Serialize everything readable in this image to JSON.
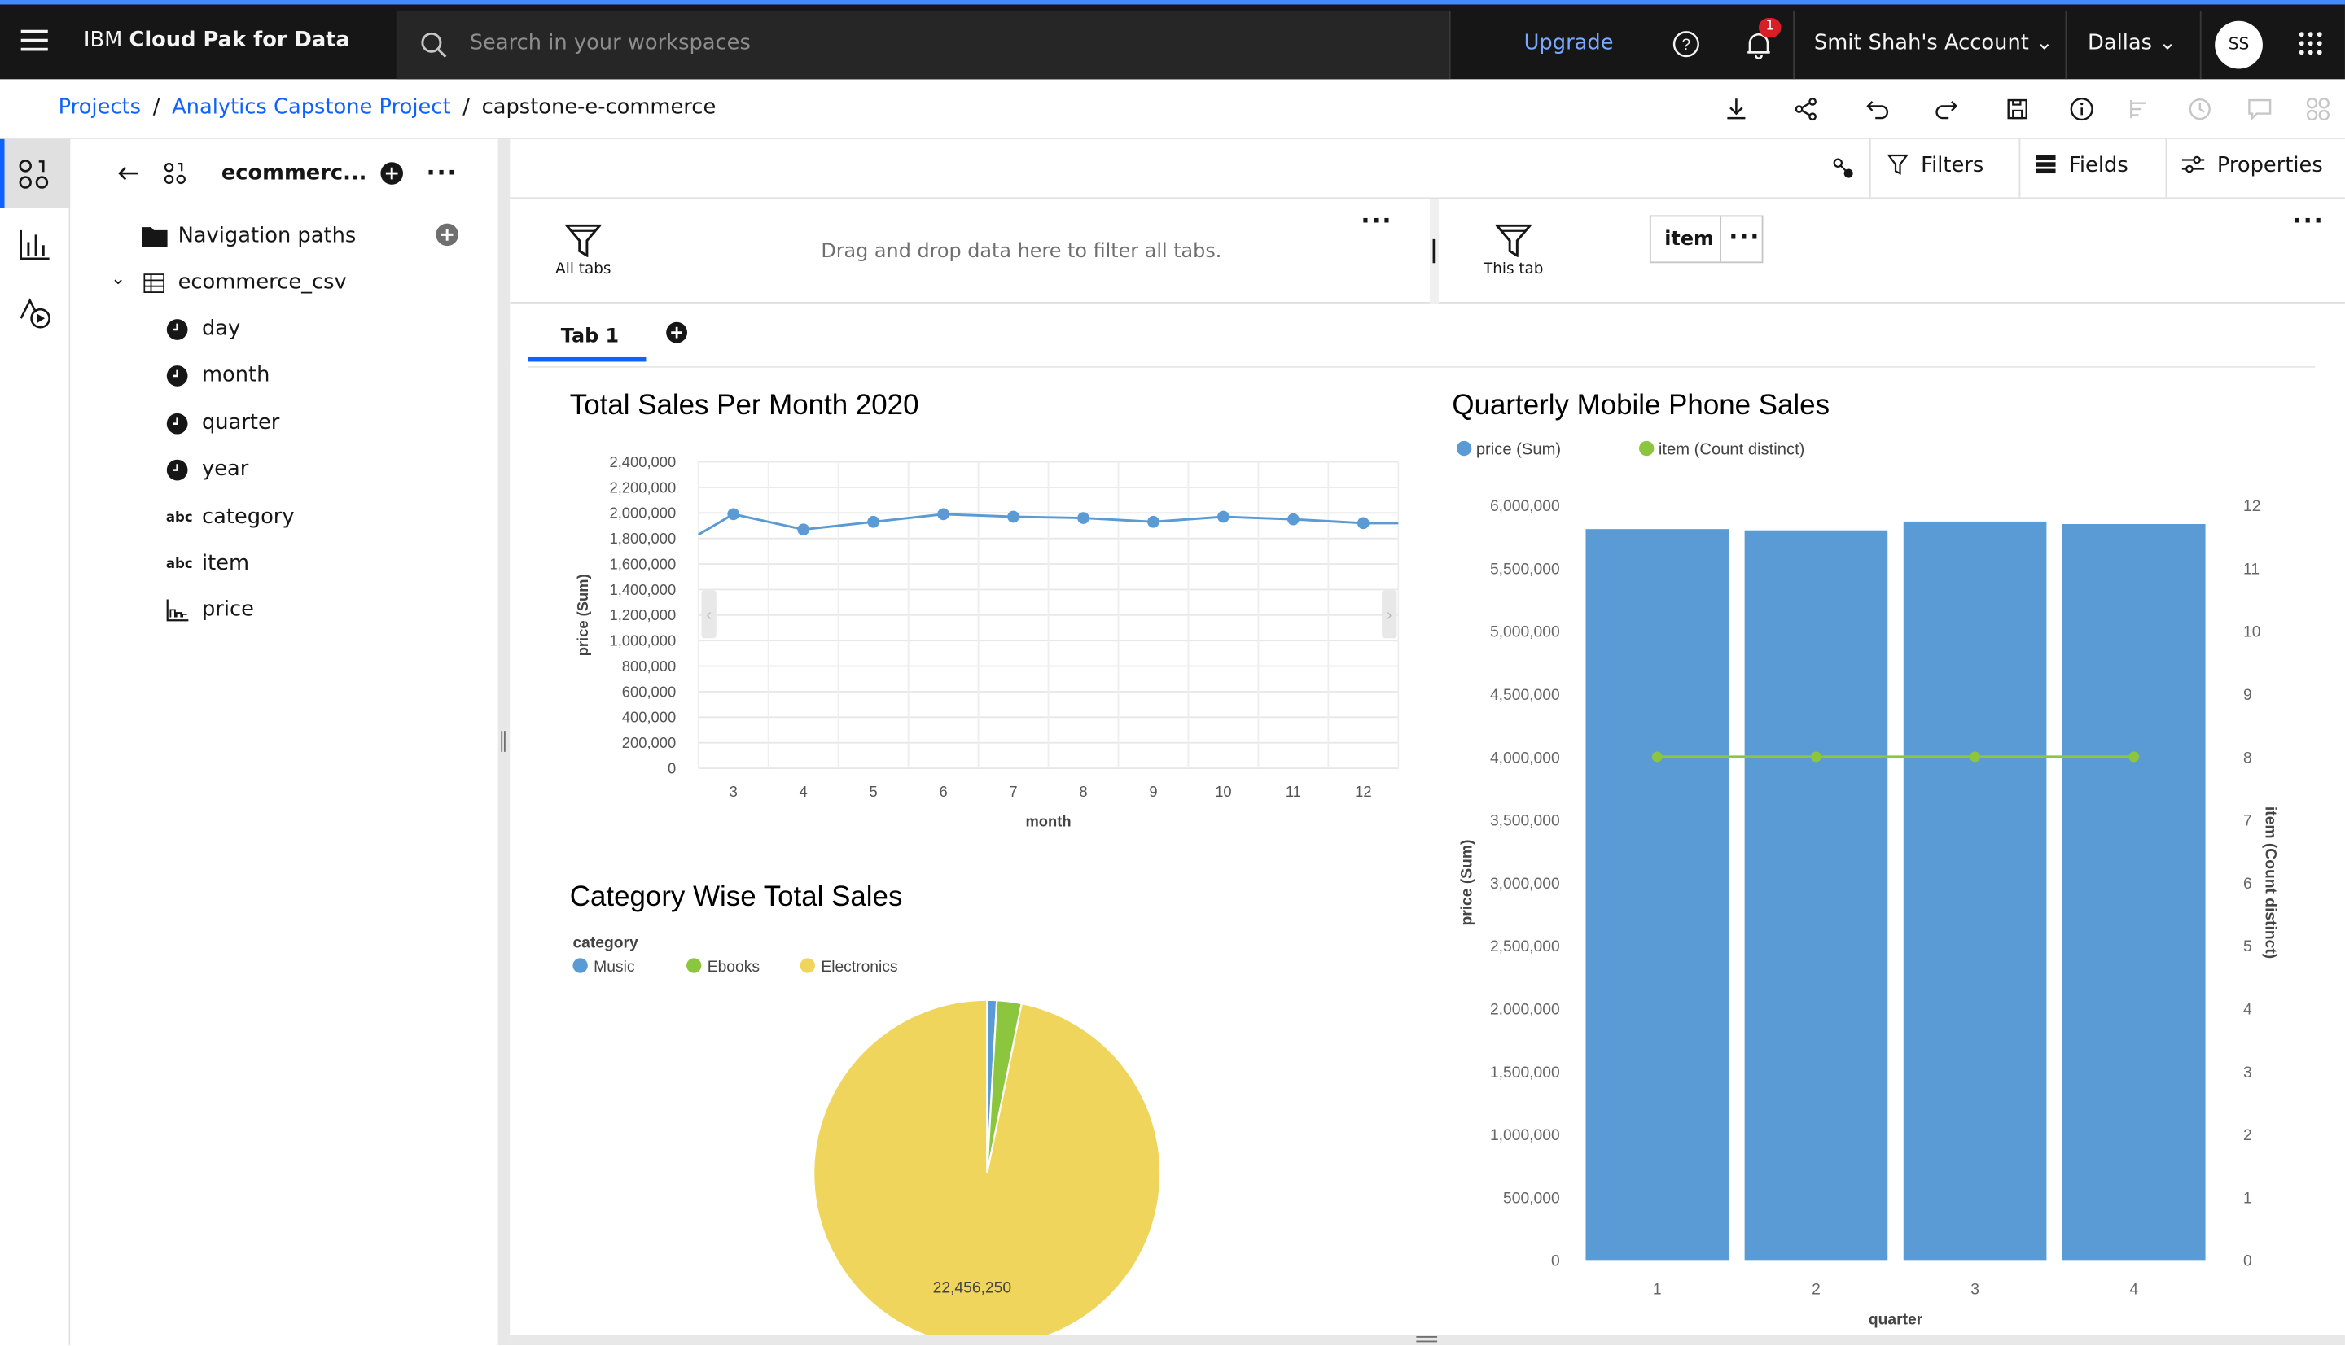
{
  "topbar": {
    "brand_prefix": "IBM ",
    "brand_name": "Cloud Pak for Data",
    "search_placeholder": "Search in your workspaces",
    "upgrade": "Upgrade",
    "notification_count": "1",
    "account": "Smit Shah's Account",
    "region": "Dallas",
    "avatar": "SS"
  },
  "breadcrumb": {
    "items": [
      "Projects",
      "Analytics Capstone Project"
    ],
    "current": "capstone-e-commerce"
  },
  "panel": {
    "title": "ecommerc...",
    "navigation_paths": "Navigation paths",
    "table_name": "ecommerce_csv",
    "fields": [
      {
        "name": "day",
        "type": "time"
      },
      {
        "name": "month",
        "type": "time"
      },
      {
        "name": "quarter",
        "type": "time"
      },
      {
        "name": "year",
        "type": "time"
      },
      {
        "name": "category",
        "type": "text"
      },
      {
        "name": "item",
        "type": "text"
      },
      {
        "name": "price",
        "type": "measure"
      }
    ],
    "abc_label": "abc"
  },
  "toolbar": {
    "filters": "Filters",
    "fields": "Fields",
    "properties": "Properties"
  },
  "filter_bar": {
    "all_tabs": "All tabs",
    "drag_text": "Drag and drop data here to filter all tabs.",
    "this_tab": "This tab",
    "item_chip": "item"
  },
  "tabs": [
    {
      "label": "Tab 1"
    }
  ],
  "chart_data": [
    {
      "type": "line",
      "title": "Total Sales Per Month 2020",
      "xlabel": "month",
      "ylabel": "price (Sum)",
      "x": [
        3,
        4,
        5,
        6,
        7,
        8,
        9,
        10,
        11,
        12
      ],
      "values": [
        1990000,
        1870000,
        1930000,
        1990000,
        1970000,
        1960000,
        1930000,
        1970000,
        1950000,
        1920000
      ],
      "partial_left_value": 1830000,
      "ylim": [
        0,
        2400000
      ],
      "yticks": [
        "2,400,000",
        "2,200,000",
        "2,000,000",
        "1,800,000",
        "1,600,000",
        "1,400,000",
        "1,200,000",
        "1,000,000",
        "800,000",
        "600,000",
        "400,000",
        "200,000",
        "0"
      ],
      "xticks": [
        "3",
        "4",
        "5",
        "6",
        "7",
        "8",
        "9",
        "10",
        "11",
        "12"
      ],
      "color": "#5b9bd5",
      "grid": true
    },
    {
      "type": "bar",
      "title": "Quarterly Mobile Phone Sales",
      "xlabel": "quarter",
      "ylabel": "price (Sum)",
      "y2label": "item (Count distinct)",
      "categories": [
        "1",
        "2",
        "3",
        "4"
      ],
      "series": [
        {
          "name": "price (Sum)",
          "values": [
            5810000,
            5800000,
            5870000,
            5850000
          ],
          "color": "#5b9bd5"
        },
        {
          "name": "item (Count distinct)",
          "values": [
            8,
            8,
            8,
            8
          ],
          "axis": "right",
          "color": "#8cc63f"
        }
      ],
      "ylim": [
        0,
        6000000
      ],
      "y2lim": [
        0,
        12
      ],
      "yticks": [
        "6,000,000",
        "5,500,000",
        "5,000,000",
        "4,500,000",
        "4,000,000",
        "3,500,000",
        "3,000,000",
        "2,500,000",
        "2,000,000",
        "1,500,000",
        "1,000,000",
        "500,000",
        "0"
      ],
      "y2ticks": [
        "12",
        "11",
        "10",
        "9",
        "8",
        "7",
        "6",
        "5",
        "4",
        "3",
        "2",
        "1",
        "0"
      ],
      "legend": "top-left"
    },
    {
      "type": "pie",
      "title": "Category Wise Total Sales",
      "legend_title": "category",
      "categories": [
        "Music",
        "Ebooks",
        "Electronics"
      ],
      "values": [
        0.9,
        2.3,
        96.8
      ],
      "colors": [
        "#5b9bd5",
        "#8cc63f",
        "#f0d55c"
      ],
      "data_label": "22,456,250",
      "legend": "top-left"
    }
  ]
}
